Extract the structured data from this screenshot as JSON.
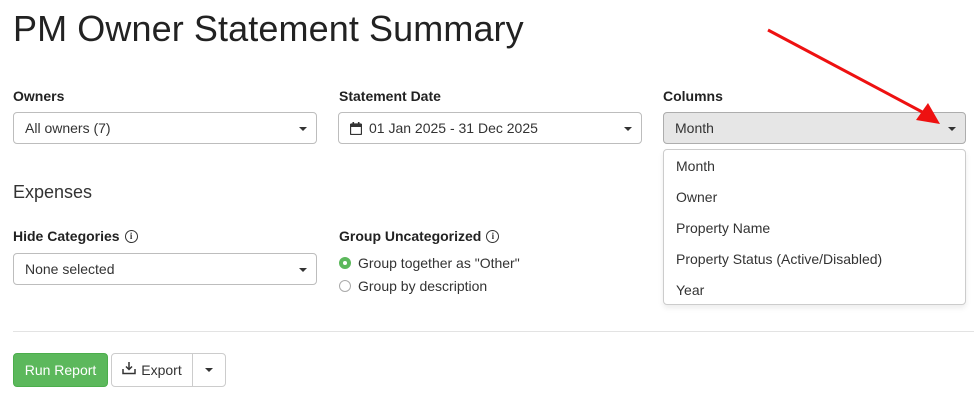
{
  "page": {
    "title": "PM Owner Statement Summary"
  },
  "owners": {
    "label": "Owners",
    "value": "All owners (7)"
  },
  "statement_date": {
    "label": "Statement Date",
    "value": "01 Jan 2025 - 31 Dec 2025",
    "icon": "calendar-icon"
  },
  "columns": {
    "label": "Columns",
    "value": "Month",
    "options": [
      "Month",
      "Owner",
      "Property Name",
      "Property Status (Active/Disabled)",
      "Year"
    ]
  },
  "expenses": {
    "title": "Expenses",
    "hide_categories": {
      "label": "Hide Categories",
      "value": "None selected"
    },
    "group_uncategorized": {
      "label": "Group Uncategorized",
      "options": [
        "Group together as \"Other\"",
        "Group by description"
      ],
      "selected_index": 0
    }
  },
  "actions": {
    "run_label": "Run Report",
    "export_label": "Export"
  },
  "annotation": {
    "arrow_color": "#ee1111"
  },
  "colors": {
    "accent_green": "#5cb85c"
  }
}
